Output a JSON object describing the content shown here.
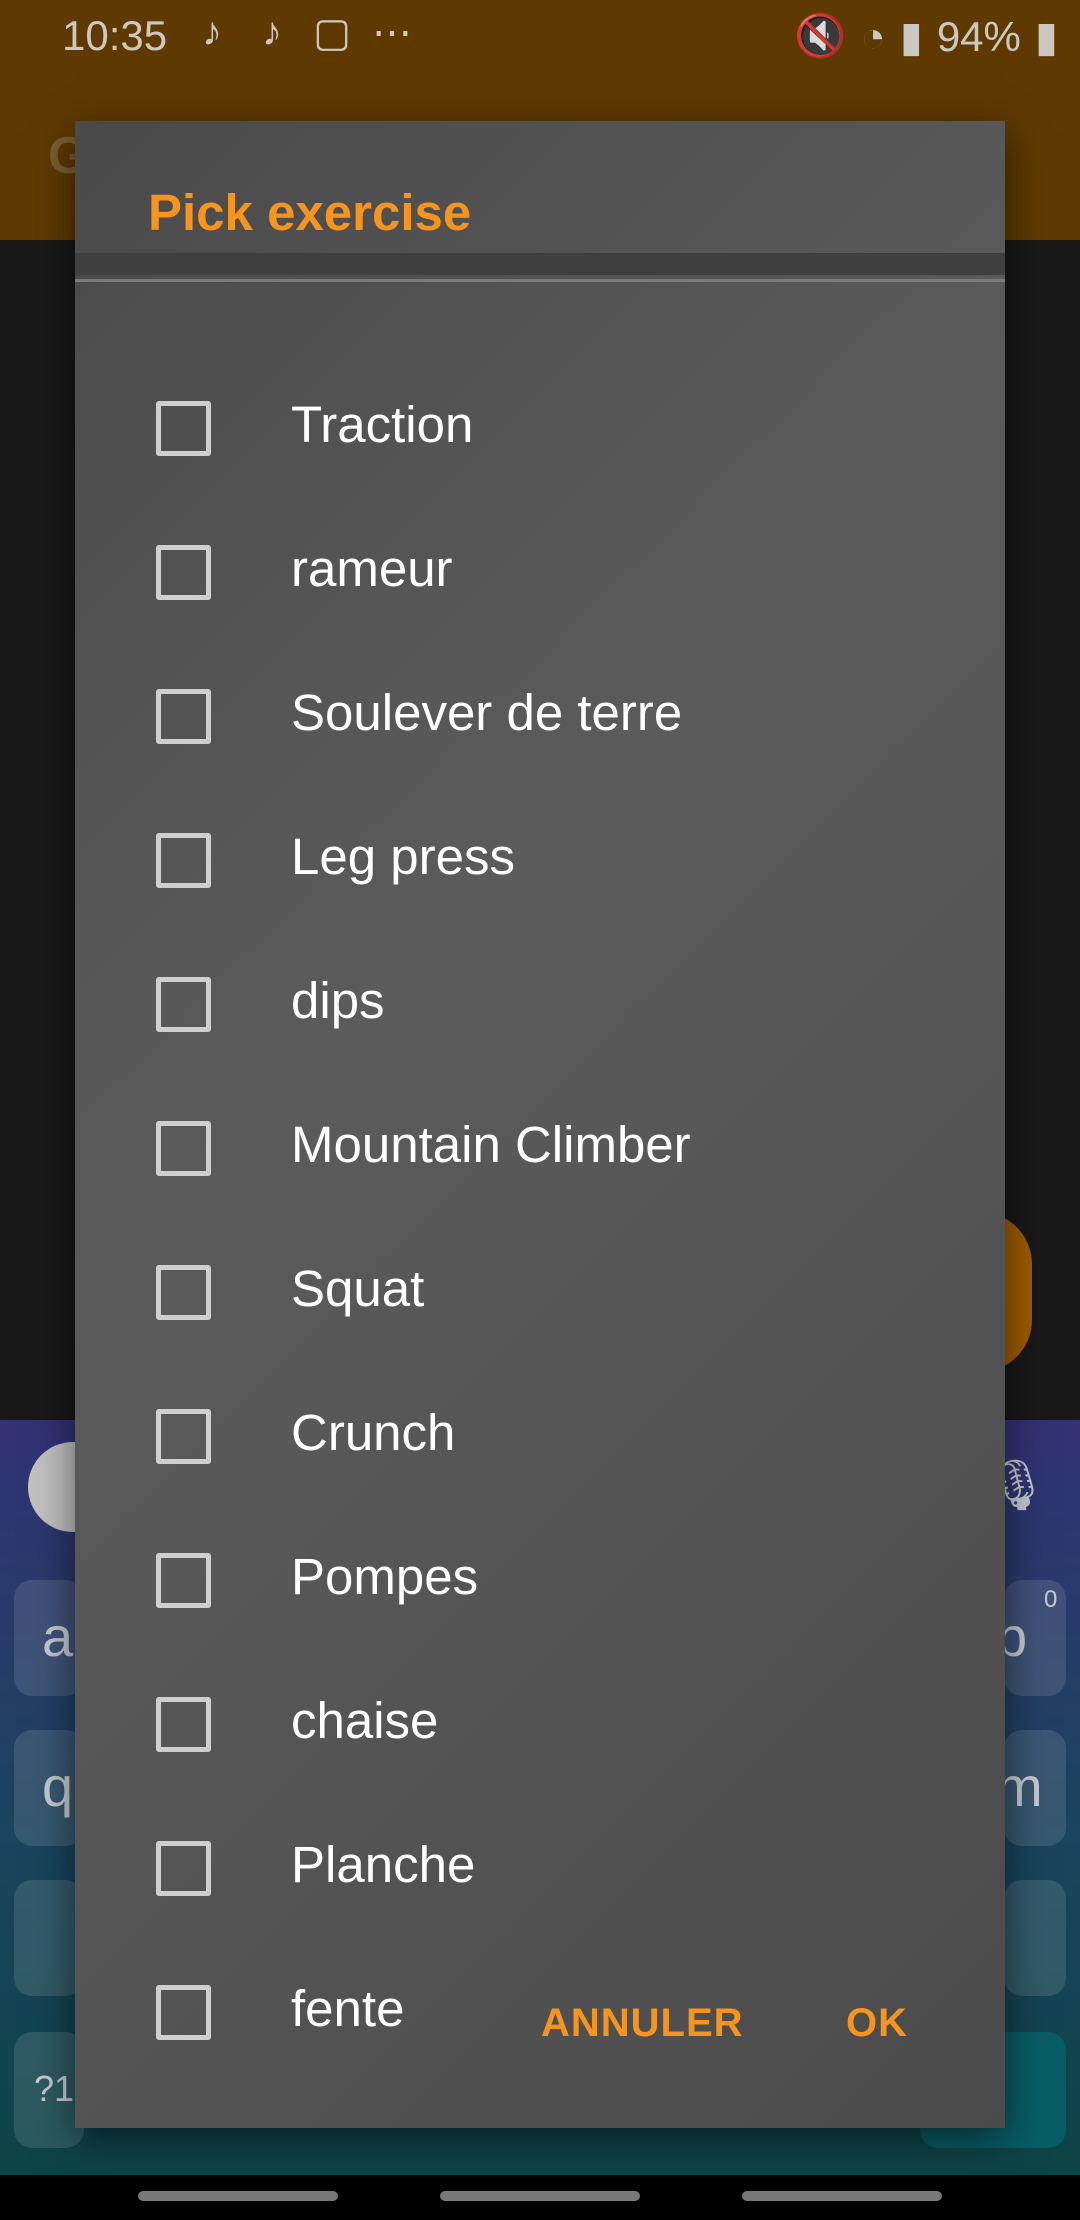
{
  "status_bar": {
    "time": "10:35",
    "notification_icons": [
      "tiktok-icon",
      "tiktok-icon",
      "twitch-icon",
      "more-icon"
    ],
    "battery": "94%"
  },
  "app_bar": {
    "title_partial": "G"
  },
  "dialog": {
    "title": "Pick exercise",
    "items": [
      {
        "label": "Traction",
        "checked": false
      },
      {
        "label": "rameur",
        "checked": false
      },
      {
        "label": "Soulever de terre",
        "checked": false
      },
      {
        "label": "Leg press",
        "checked": false
      },
      {
        "label": "dips",
        "checked": false
      },
      {
        "label": "Mountain Climber",
        "checked": false
      },
      {
        "label": "Squat",
        "checked": false
      },
      {
        "label": "Crunch",
        "checked": false
      },
      {
        "label": "Pompes",
        "checked": false
      },
      {
        "label": "chaise",
        "checked": false
      },
      {
        "label": "Planche",
        "checked": false
      },
      {
        "label": "fente",
        "checked": false
      }
    ],
    "cancel_label": "ANNULER",
    "ok_label": "OK"
  },
  "keyboard": {
    "visible_keys": [
      "a",
      "p",
      "q",
      "m",
      "?1"
    ],
    "number_hint_p": "0"
  },
  "colors": {
    "accent": "#f7941d",
    "app_bar": "#6b4300",
    "dialog_bg": "#4f4f4f"
  }
}
